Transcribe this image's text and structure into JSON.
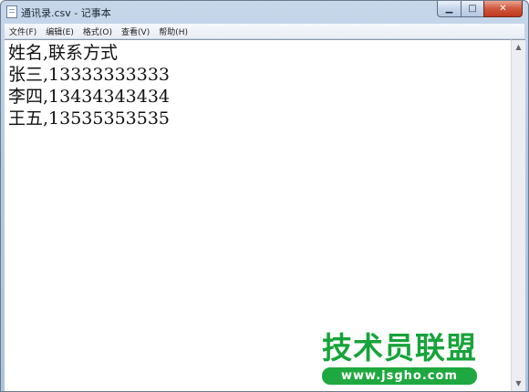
{
  "window": {
    "title": "通讯录.csv - 记事本",
    "controls": {
      "minimize": "▁",
      "maximize": "□",
      "close": "✕"
    }
  },
  "menu": [
    {
      "label": "文件(F)"
    },
    {
      "label": "编辑(E)"
    },
    {
      "label": "格式(O)"
    },
    {
      "label": "查看(V)"
    },
    {
      "label": "帮助(H)"
    }
  ],
  "content": {
    "lines": [
      "姓名,联系方式",
      "张三,13333333333",
      "李四,13434343434",
      "王五,13535353535"
    ]
  },
  "scrollbar": {
    "up": "▲",
    "down": "▼"
  },
  "watermark": {
    "title": "技术员联盟",
    "url": "www.jsgho.com"
  },
  "colors": {
    "watermark_green": "#1fa83f",
    "close_red": "#c7432a"
  },
  "icons": {
    "app": "notepad-icon"
  }
}
